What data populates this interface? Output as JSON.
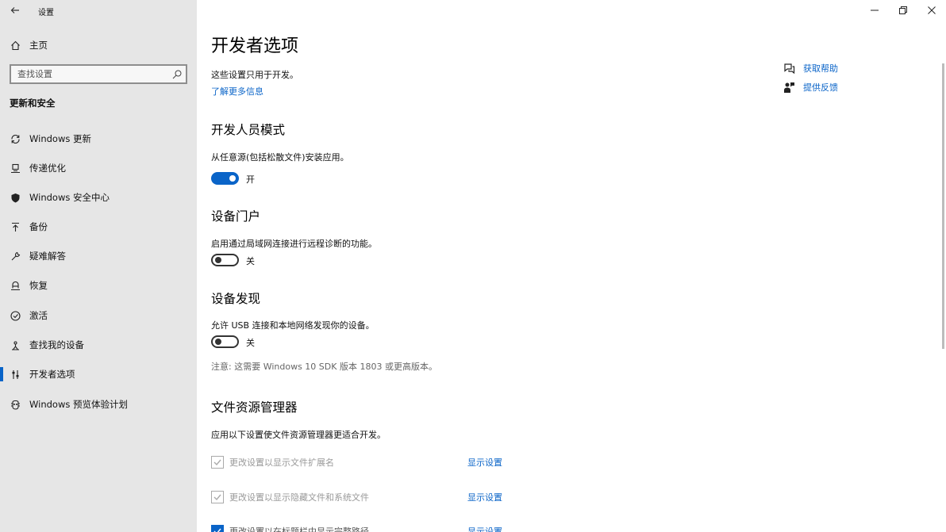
{
  "window": {
    "title": "设置"
  },
  "sidebar": {
    "home_label": "主页",
    "search_placeholder": "查找设置",
    "section_title": "更新和安全",
    "items": [
      {
        "label": "Windows 更新",
        "icon": "sync-icon"
      },
      {
        "label": "传递优化",
        "icon": "delivery-optimization-icon"
      },
      {
        "label": "Windows 安全中心",
        "icon": "shield-icon"
      },
      {
        "label": "备份",
        "icon": "backup-arrow-icon"
      },
      {
        "label": "疑难解答",
        "icon": "wrench-icon"
      },
      {
        "label": "恢复",
        "icon": "recovery-icon"
      },
      {
        "label": "激活",
        "icon": "check-circle-icon"
      },
      {
        "label": "查找我的设备",
        "icon": "find-device-icon"
      },
      {
        "label": "开发者选项",
        "icon": "developer-sliders-icon",
        "active": true
      },
      {
        "label": "Windows 预览体验计划",
        "icon": "insider-icon"
      }
    ]
  },
  "main": {
    "title": "开发者选项",
    "intro": "这些设置只用于开发。",
    "learn_more": "了解更多信息",
    "help": {
      "get_help": "获取帮助",
      "feedback": "提供反馈"
    },
    "dev_mode": {
      "heading": "开发人员模式",
      "desc": "从任意源(包括松散文件)安装应用。",
      "toggle_state": "开"
    },
    "device_portal": {
      "heading": "设备门户",
      "desc": "启用通过局域网连接进行远程诊断的功能。",
      "toggle_state": "关"
    },
    "device_discovery": {
      "heading": "设备发现",
      "desc": "允许 USB 连接和本地网络发现你的设备。",
      "toggle_state": "关",
      "note": "注意: 这需要 Windows 10 SDK 版本 1803 或更高版本。"
    },
    "file_explorer": {
      "heading": "文件资源管理器",
      "desc": "应用以下设置使文件资源管理器更适合开发。",
      "options": [
        {
          "label": "更改设置以显示文件扩展名",
          "action": "显示设置"
        },
        {
          "label": "更改设置以显示隐藏文件和系统文件",
          "action": "显示设置"
        },
        {
          "label": "更改设置以在标题栏中显示完整路径",
          "action": "显示设置"
        }
      ]
    }
  },
  "colors": {
    "accent": "#0a64c8",
    "sidebar_bg": "#e6e6e6"
  }
}
